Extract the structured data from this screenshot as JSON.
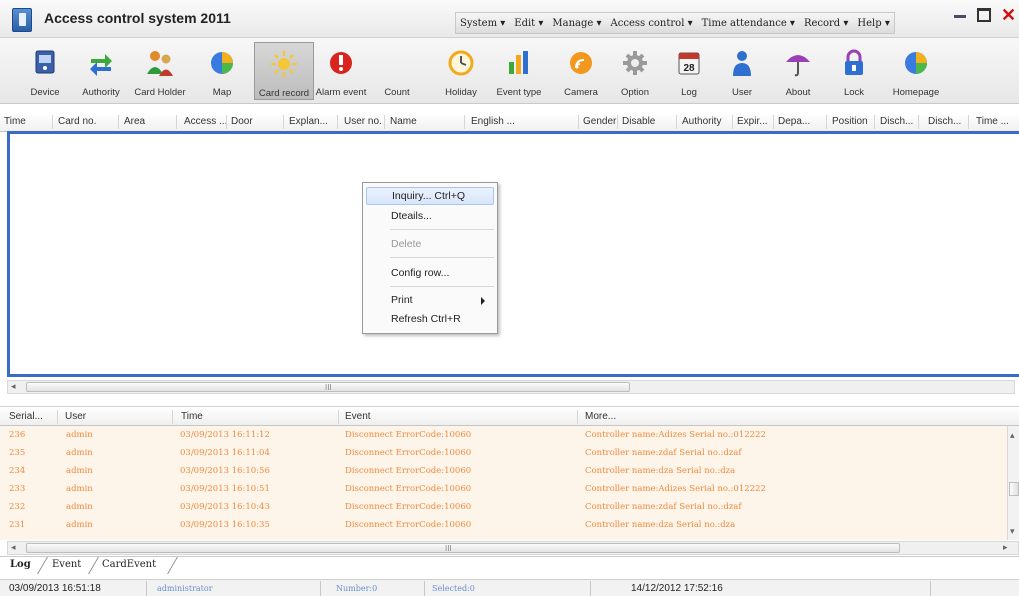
{
  "window": {
    "title": "Access control system 2011",
    "menu": [
      "System",
      "Edit",
      "Manage",
      "Access control",
      "Time attendance",
      "Record",
      "Help"
    ]
  },
  "toolbar": [
    {
      "label": "Device",
      "icon": "device-icon"
    },
    {
      "label": "Authority",
      "icon": "authority-icon"
    },
    {
      "label": "Card Holder",
      "icon": "card-holder-icon"
    },
    {
      "label": "Map",
      "icon": "map-icon"
    },
    {
      "label": "Card record",
      "icon": "card-record-icon",
      "active": true
    },
    {
      "label": "Alarm event",
      "icon": "alarm-icon"
    },
    {
      "label": "Count",
      "icon": "count-icon"
    },
    {
      "label": "Holiday",
      "icon": "holiday-icon"
    },
    {
      "label": "Event type",
      "icon": "event-type-icon"
    },
    {
      "label": "Camera",
      "icon": "camera-icon"
    },
    {
      "label": "Option",
      "icon": "option-icon"
    },
    {
      "label": "Log",
      "icon": "log-icon",
      "badge": "28"
    },
    {
      "label": "User",
      "icon": "user-icon"
    },
    {
      "label": "About",
      "icon": "about-icon"
    },
    {
      "label": "Lock",
      "icon": "lock-icon"
    },
    {
      "label": "Homepage",
      "icon": "homepage-icon"
    }
  ],
  "grid_columns": [
    "Time",
    "Card no.",
    "Area",
    "Access ...",
    "Door",
    "Explan...",
    "User no.",
    "Name",
    "English ...",
    "Gender",
    "Disable",
    "Authority",
    "Expir...",
    "Depa...",
    "Position",
    "Disch...",
    "Disch...",
    "Time ..."
  ],
  "context_menu": {
    "inquiry": "Inquiry... Ctrl+Q",
    "details": "Dteails...",
    "delete": "Delete",
    "config_row": "Config row...",
    "print": "Print",
    "refresh": "Refresh   Ctrl+R"
  },
  "scroll_grip": "III",
  "log_columns": [
    "Serial...",
    "User",
    "Time",
    "Event",
    "More..."
  ],
  "log_rows": [
    {
      "serial": "236",
      "user": "admin",
      "time": "03/09/2013 16:11:12",
      "event": "Disconnect ErrorCode:10060",
      "more": "Controller name:Adizes Serial no.:012222"
    },
    {
      "serial": "235",
      "user": "admin",
      "time": "03/09/2013 16:11:04",
      "event": "Disconnect ErrorCode:10060",
      "more": "Controller name:zdaf Serial no.:dzaf"
    },
    {
      "serial": "234",
      "user": "admin",
      "time": "03/09/2013 16:10:56",
      "event": "Disconnect ErrorCode:10060",
      "more": "Controller name:dza Serial no.:dza"
    },
    {
      "serial": "233",
      "user": "admin",
      "time": "03/09/2013 16:10:51",
      "event": "Disconnect ErrorCode:10060",
      "more": "Controller name:Adizes Serial no.:012222"
    },
    {
      "serial": "232",
      "user": "admin",
      "time": "03/09/2013 16:10:43",
      "event": "Disconnect ErrorCode:10060",
      "more": "Controller name:zdaf Serial no.:dzaf"
    },
    {
      "serial": "231",
      "user": "admin",
      "time": "03/09/2013 16:10:35",
      "event": "Disconnect ErrorCode:10060",
      "more": "Controller name:dza Serial no.:dza"
    }
  ],
  "tabs": [
    "Log",
    "Event",
    "CardEvent"
  ],
  "status": {
    "datetime": "03/09/2013 16:51:18",
    "user": "administrator",
    "number": "Number:0",
    "selected": "Selected:0",
    "clock": "14/12/2012 17:52:16"
  },
  "colors": {
    "grid_border": "#3a6bc7",
    "log_text": "#f08a3c",
    "log_background": "#fdf4ea",
    "close_button": "#d01010"
  }
}
